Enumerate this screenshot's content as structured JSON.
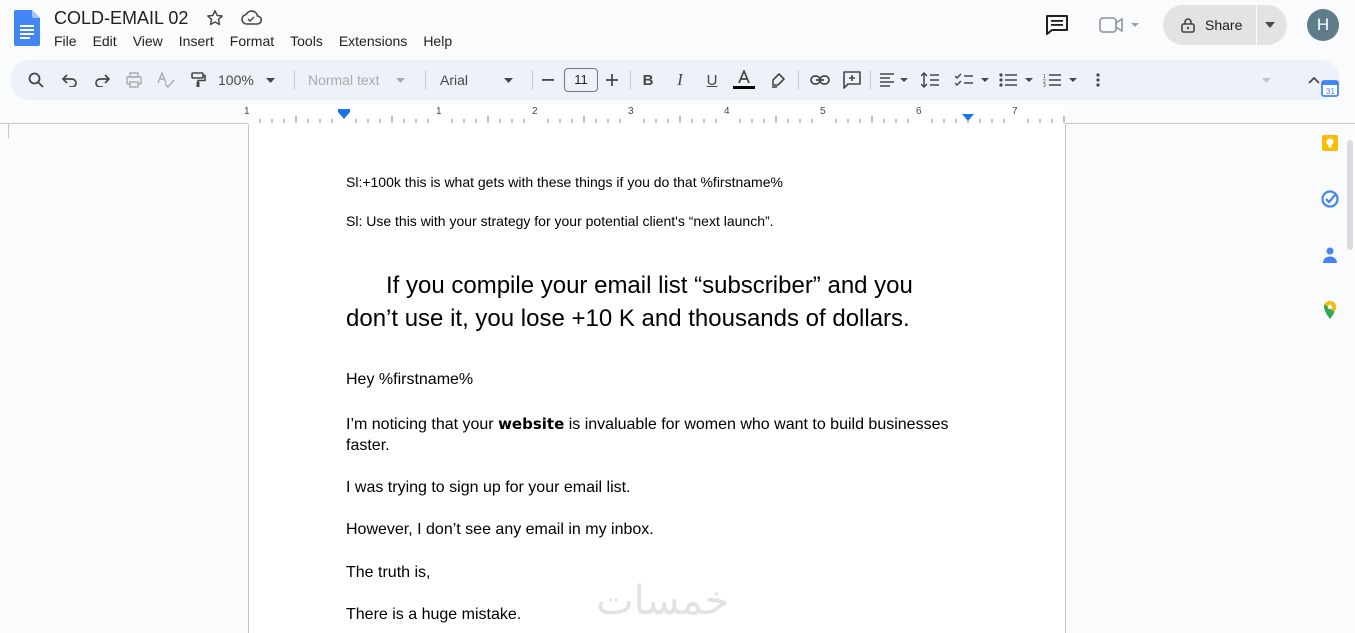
{
  "app": {
    "document_title": "COLD-EMAIL 02",
    "menu": [
      "File",
      "Edit",
      "View",
      "Insert",
      "Format",
      "Tools",
      "Extensions",
      "Help"
    ],
    "share_label": "Share",
    "avatar_initial": "H"
  },
  "toolbar": {
    "zoom": "100%",
    "style": "Normal text",
    "font": "Arial",
    "font_size": "11"
  },
  "ruler": {
    "numbers": [
      "1",
      "1",
      "2",
      "3",
      "4",
      "5",
      "6",
      "7"
    ]
  },
  "document": {
    "line1": "Sl:+100k this is what gets with these things if you do that %firstname%",
    "line2": "Sl: Use this with your strategy for your potential client's “next launch”.",
    "heading_line1": "If you compile your email list “subscriber” and you",
    "heading_line2": "don’t use it, you lose +10 K and thousands of dollars.",
    "greeting": "Hey %firstname%",
    "para1_before": "I’m noticing that your ",
    "para1_bold": "website",
    "para1_after": " is invaluable for women who want to build businesses",
    "para1_line2": "faster.",
    "para2": "I was trying to sign up for your email list.",
    "para3": "However, I don’t see any email in my inbox.",
    "para4": "The truth is,",
    "para5": "There is a huge mistake."
  },
  "watermark": "خمسات",
  "colors": {
    "docs_blue": "#4285f4",
    "toolbar_bg": "#edf2fa",
    "share_bg": "#e3e3e3"
  }
}
